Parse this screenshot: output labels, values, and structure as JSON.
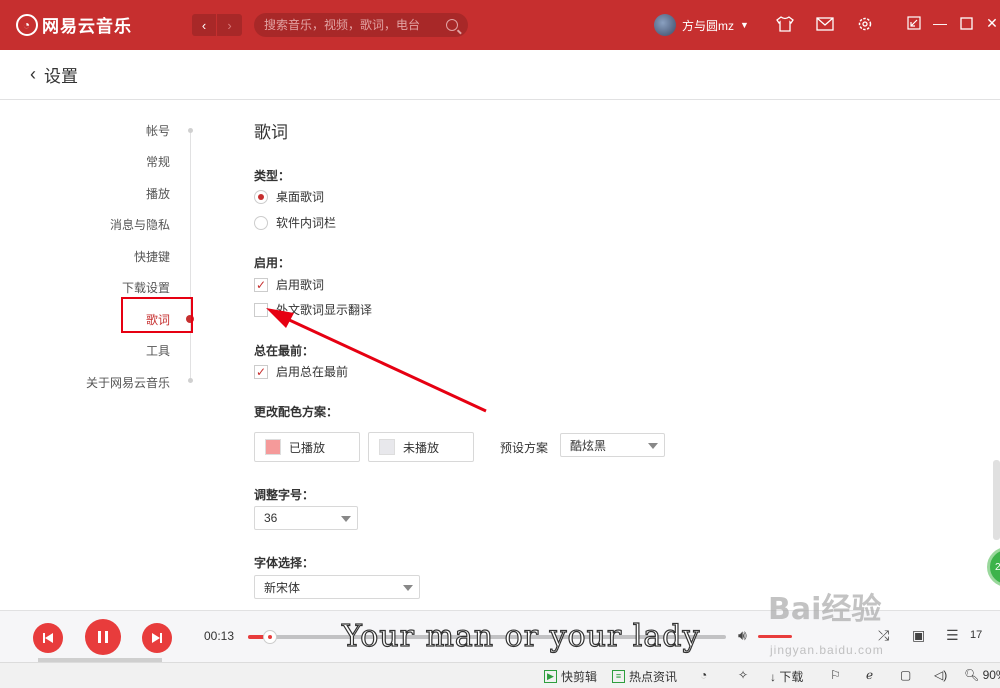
{
  "app": {
    "name": "网易云音乐",
    "search_placeholder": "搜索音乐，视频，歌词，电台",
    "user_name": "方与圆mz",
    "brand_color": "#c62f2f"
  },
  "header": {
    "title": "设置"
  },
  "sidebar": {
    "items": [
      {
        "label": "帐号"
      },
      {
        "label": "常规"
      },
      {
        "label": "播放"
      },
      {
        "label": "消息与隐私"
      },
      {
        "label": "快捷键"
      },
      {
        "label": "下载设置"
      },
      {
        "label": "歌词"
      },
      {
        "label": "工具"
      },
      {
        "label": "关于网易云音乐"
      }
    ],
    "active": "歌词"
  },
  "lyrics": {
    "title": "歌词",
    "type_label": "类型：",
    "type_options": [
      "桌面歌词",
      "软件内词栏"
    ],
    "type_selected": "桌面歌词",
    "enable_label": "启用：",
    "enable_lyrics": "启用歌词",
    "enable_lyrics_checked": true,
    "show_translation": "外文歌词显示翻译",
    "show_translation_checked": false,
    "ontop_label": "总在最前：",
    "ontop_option": "启用总在最前",
    "ontop_checked": true,
    "color_label": "更改配色方案：",
    "played_label": "已播放",
    "unplayed_label": "未播放",
    "preset_label": "预设方案",
    "preset_value": "酷炫黑",
    "size_label": "调整字号：",
    "size_value": "36",
    "font_label": "字体选择：",
    "font_value": "新宋体"
  },
  "player": {
    "time": "00:13",
    "progress_fraction": 0.045,
    "desktop_lyric": "Your man or your lady",
    "playlist_count": "17"
  },
  "taskbar": {
    "items": [
      "快剪辑",
      "热点资讯",
      "下载",
      "90%"
    ]
  },
  "watermark": {
    "text": "Bai经验",
    "sub": "jingyan.baidu.com"
  }
}
